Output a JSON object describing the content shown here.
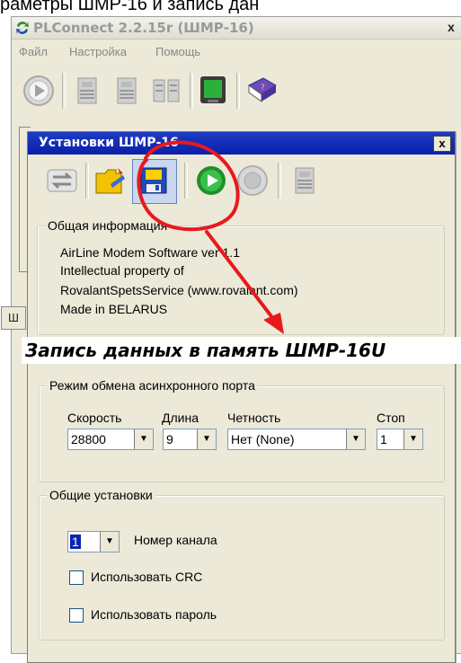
{
  "top_strip_text": "раметры ШМР-16  и запись дан",
  "main_window": {
    "title": "PLConnect 2.2.15r (ШМР-16)",
    "close_label": "x",
    "menu": [
      "Файл",
      "Настройка",
      "Помощь"
    ],
    "status_tab_label": "Ш"
  },
  "dialog": {
    "title": "Установки ШМР-16",
    "close_label": "x",
    "info_group": {
      "legend": "Общая информация",
      "lines": [
        "AirLine Modem Software ver 1.1",
        "Intellectual property of",
        "RovalantSpetsService (www.rovalant.com)",
        "Made in BELARUS"
      ]
    },
    "port_group": {
      "legend": "Режим обмена асинхронного порта",
      "speed_label": "Скорость",
      "length_label": "Длина",
      "parity_label": "Четность",
      "stop_label": "Стоп",
      "speed_value": "28800",
      "length_value": "9",
      "parity_value": "Нет (None)",
      "stop_value": "1"
    },
    "general_group": {
      "legend": "Общие установки",
      "channel_value": "1",
      "channel_label": "Номер канала",
      "crc_label": "Использовать CRC",
      "password_label": "Использовать пароль"
    }
  },
  "annotation_caption": "Запись данных в память ШМР-16U",
  "colors": {
    "dialog_title_bg": "#0a24b0",
    "annotation_red": "#e8191d",
    "window_bg": "#ece9d8"
  }
}
